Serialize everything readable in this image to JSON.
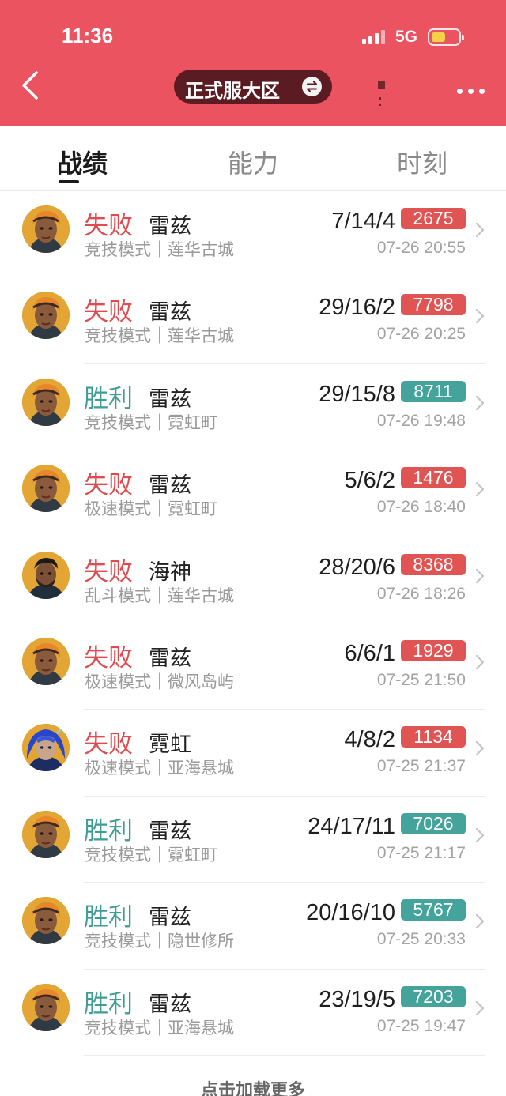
{
  "status_bar": {
    "time": "11:36",
    "network": "5G"
  },
  "header": {
    "region_label": "正式服大区"
  },
  "tabs": [
    {
      "label": "战绩",
      "active": true
    },
    {
      "label": "能力",
      "active": false
    },
    {
      "label": "时刻",
      "active": false
    }
  ],
  "matches": [
    {
      "result": "失败",
      "outcome": "loss",
      "hero": "雷兹",
      "mode": "竞技模式｜莲华古城",
      "kda": "7/14/4",
      "score": "2675",
      "time": "07-26 20:55",
      "avatar": "raze-avatar"
    },
    {
      "result": "失败",
      "outcome": "loss",
      "hero": "雷兹",
      "mode": "竞技模式｜莲华古城",
      "kda": "29/16/2",
      "score": "7798",
      "time": "07-26 20:25",
      "avatar": "raze-avatar"
    },
    {
      "result": "胜利",
      "outcome": "win",
      "hero": "雷兹",
      "mode": "竞技模式｜霓虹町",
      "kda": "29/15/8",
      "score": "8711",
      "time": "07-26 19:48",
      "avatar": "raze-avatar"
    },
    {
      "result": "失败",
      "outcome": "loss",
      "hero": "雷兹",
      "mode": "极速模式｜霓虹町",
      "kda": "5/6/2",
      "score": "1476",
      "time": "07-26 18:40",
      "avatar": "raze-avatar"
    },
    {
      "result": "失败",
      "outcome": "loss",
      "hero": "海神",
      "mode": "乱斗模式｜莲华古城",
      "kda": "28/20/6",
      "score": "8368",
      "time": "07-26 18:26",
      "avatar": "harbor-avatar"
    },
    {
      "result": "失败",
      "outcome": "loss",
      "hero": "雷兹",
      "mode": "极速模式｜微风岛屿",
      "kda": "6/6/1",
      "score": "1929",
      "time": "07-25 21:50",
      "avatar": "raze-avatar"
    },
    {
      "result": "失败",
      "outcome": "loss",
      "hero": "霓虹",
      "mode": "极速模式｜亚海悬城",
      "kda": "4/8/2",
      "score": "1134",
      "time": "07-25 21:37",
      "avatar": "neon-avatar"
    },
    {
      "result": "胜利",
      "outcome": "win",
      "hero": "雷兹",
      "mode": "竞技模式｜霓虹町",
      "kda": "24/17/11",
      "score": "7026",
      "time": "07-25 21:17",
      "avatar": "raze-avatar"
    },
    {
      "result": "胜利",
      "outcome": "win",
      "hero": "雷兹",
      "mode": "竞技模式｜隐世修所",
      "kda": "20/16/10",
      "score": "5767",
      "time": "07-25 20:33",
      "avatar": "raze-avatar"
    },
    {
      "result": "胜利",
      "outcome": "win",
      "hero": "雷兹",
      "mode": "竞技模式｜亚海悬城",
      "kda": "23/19/5",
      "score": "7203",
      "time": "07-25 19:47",
      "avatar": "raze-avatar"
    }
  ],
  "footer": {
    "load_more": "点击加载更多"
  },
  "colors": {
    "header_bg": "#ea535f",
    "loss": "#e04b4f",
    "win": "#3e9d96",
    "loss_badge": "#e05454",
    "win_badge": "#44a39b"
  }
}
